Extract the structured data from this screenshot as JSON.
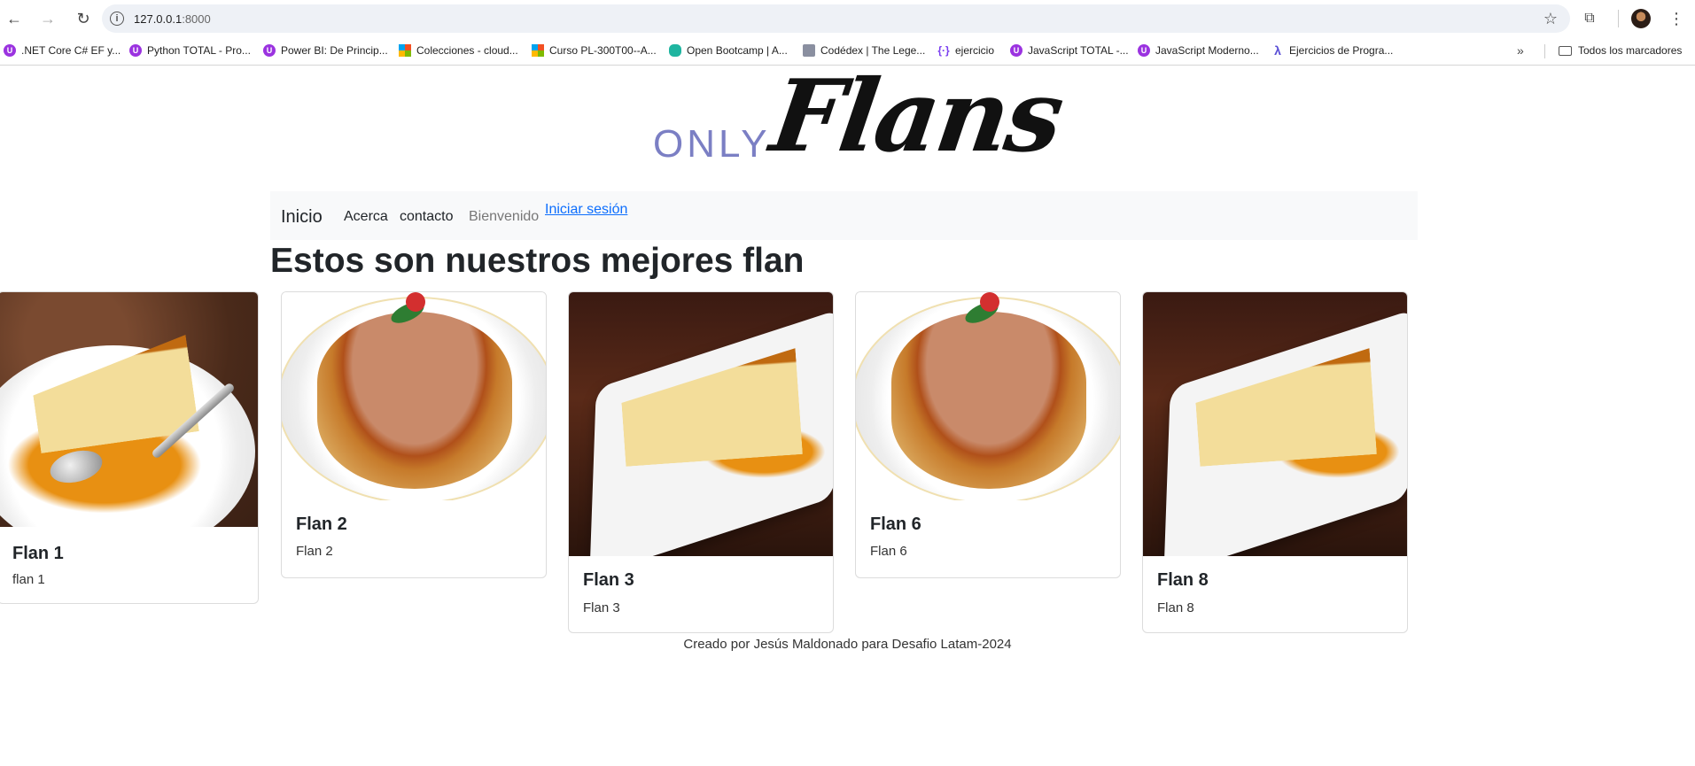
{
  "browser": {
    "url_host": "127.0.0.1",
    "url_port": ":8000",
    "bookmarks": [
      {
        "label": ".NET Core C# EF y...",
        "icon": "udemy-icon"
      },
      {
        "label": "Python TOTAL - Pro...",
        "icon": "udemy-icon"
      },
      {
        "label": "Power BI: De Princip...",
        "icon": "udemy-icon"
      },
      {
        "label": "Colecciones - cloud...",
        "icon": "microsoft-icon"
      },
      {
        "label": "Curso PL-300T00--A...",
        "icon": "microsoft-icon"
      },
      {
        "label": "Open Bootcamp | A...",
        "icon": "openbootcamp-icon"
      },
      {
        "label": "Codédex | The Lege...",
        "icon": "codedex-icon"
      },
      {
        "label": "ejercicio",
        "icon": "brackets-icon"
      },
      {
        "label": "JavaScript TOTAL -...",
        "icon": "udemy-icon"
      },
      {
        "label": "JavaScript Moderno...",
        "icon": "udemy-icon"
      },
      {
        "label": "Ejercicios de Progra...",
        "icon": "lambda-icon"
      }
    ],
    "all_bookmarks": "Todos los marcadores"
  },
  "logo": {
    "only": "ONLY",
    "flans": "Flans"
  },
  "nav": {
    "brand": "Inicio",
    "links": [
      "Acerca",
      "contacto"
    ],
    "welcome": "Bienvenido",
    "login": "Iniciar sesión"
  },
  "heading": "Estos son nuestros mejores flan",
  "cards": [
    {
      "title": "Flan 1",
      "text": "flan 1"
    },
    {
      "title": "Flan 2",
      "text": "Flan 2"
    },
    {
      "title": "Flan 3",
      "text": "Flan 3"
    },
    {
      "title": "Flan 6",
      "text": "Flan 6"
    },
    {
      "title": "Flan 8",
      "text": "Flan 8"
    }
  ],
  "footer": "Creado por Jesús Maldonado para Desafio Latam-2024"
}
